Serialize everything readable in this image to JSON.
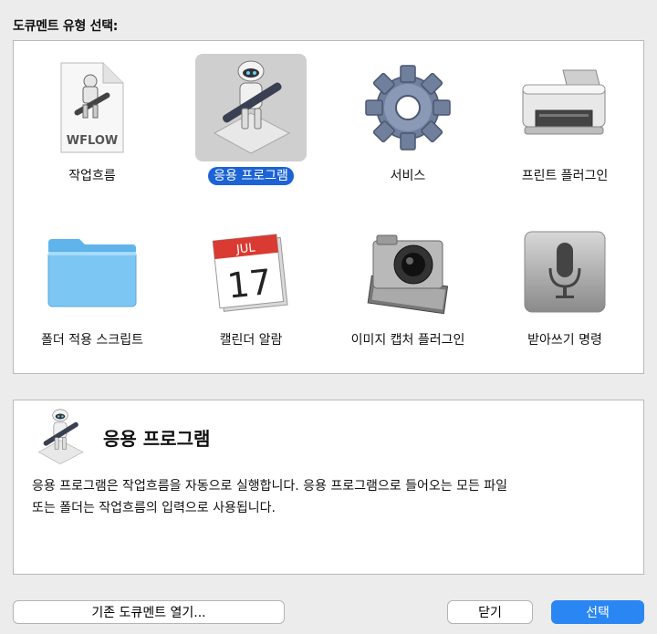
{
  "heading": "도큐멘트 유형 선택:",
  "templates": [
    {
      "label": "작업흐름",
      "icon": "workflow-document-icon",
      "selected": false
    },
    {
      "label": "응용 프로그램",
      "icon": "automator-robot-icon",
      "selected": true
    },
    {
      "label": "서비스",
      "icon": "gear-icon",
      "selected": false
    },
    {
      "label": "프린트 플러그인",
      "icon": "printer-icon",
      "selected": false
    },
    {
      "label": "폴더 적용 스크립트",
      "icon": "folder-icon",
      "selected": false
    },
    {
      "label": "캘린더 알람",
      "icon": "calendar-icon",
      "selected": false
    },
    {
      "label": "이미지 캡처 플러그인",
      "icon": "camera-icon",
      "selected": false
    },
    {
      "label": "받아쓰기 명령",
      "icon": "microphone-icon",
      "selected": false
    }
  ],
  "workflow_doc_text": "WFLOW",
  "calendar": {
    "month": "JUL",
    "day": "17"
  },
  "description": {
    "title": "응용 프로그램",
    "line1": "응용 프로그램은 작업흐름을 자동으로 실행합니다. 응용 프로그램으로 들어오는 모든 파일",
    "line2": "또는 폴더는 작업흐름의 입력으로 사용됩니다."
  },
  "buttons": {
    "open_existing": "기존 도큐멘트 열기...",
    "close": "닫기",
    "choose": "선택"
  },
  "colors": {
    "accent": "#1c63d5",
    "primary_button": "#2a86f3",
    "window_bg": "#ececec"
  }
}
